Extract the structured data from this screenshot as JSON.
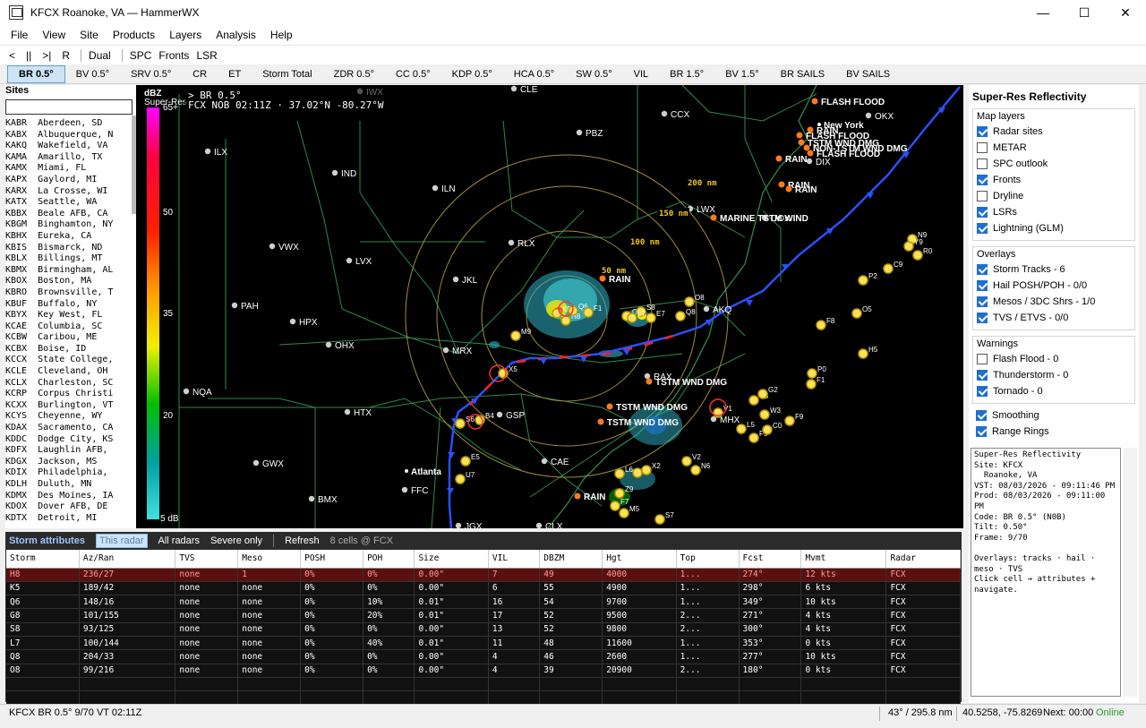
{
  "window": {
    "title": "KFCX Roanoke, VA — HammerWX",
    "min": "—",
    "max": "☐",
    "close": "✕"
  },
  "menu": [
    "File",
    "View",
    "Site",
    "Products",
    "Layers",
    "Analysis",
    "Help"
  ],
  "toolbar": {
    "prev": "<",
    "pause": "||",
    "next": ">|",
    "reset": "R",
    "dual": "Dual",
    "spc": "SPC",
    "fronts": "Fronts",
    "lsr": "LSR"
  },
  "product_tabs": [
    "BR 0.5°",
    "BV 0.5°",
    "SRV 0.5°",
    "CR",
    "ET",
    "Storm Total",
    "ZDR 0.5°",
    "CC 0.5°",
    "KDP 0.5°",
    "HCA 0.5°",
    "SW 0.5°",
    "VIL",
    "BR 1.5°",
    "BV 1.5°",
    "BR SAILS",
    "BV SAILS"
  ],
  "sites": {
    "header": "Sites",
    "list": [
      "KABR  Aberdeen, SD",
      "KABX  Albuquerque, N",
      "KAKQ  Wakefield, VA",
      "KAMA  Amarillo, TX",
      "KAMX  Miami, FL",
      "KAPX  Gaylord, MI",
      "KARX  La Crosse, WI",
      "KATX  Seattle, WA",
      "KBBX  Beale AFB, CA",
      "KBGM  Binghamton, NY",
      "KBHX  Eureka, CA",
      "KBIS  Bismarck, ND",
      "KBLX  Billings, MT",
      "KBMX  Birmingham, AL",
      "KBOX  Boston, MA",
      "KBRO  Brownsville, T",
      "KBUF  Buffalo, NY",
      "KBYX  Key West, FL",
      "KCAE  Columbia, SC",
      "KCBW  Caribou, ME",
      "KCBX  Boise, ID",
      "KCCX  State College,",
      "KCLE  Cleveland, OH",
      "KCLX  Charleston, SC",
      "KCRP  Corpus Christi",
      "KCXX  Burlington, VT",
      "KCYS  Cheyenne, WY",
      "KDAX  Sacramento, CA",
      "KDDC  Dodge City, KS",
      "KDFX  Laughlin AFB,",
      "KDGX  Jackson, MS",
      "KDIX  Philadelphia,",
      "KDLH  Duluth, MN",
      "KDMX  Des Moines, IA",
      "KDOX  Dover AFB, DE",
      "KDTX  Detroit, MI"
    ]
  },
  "map": {
    "info": "> BR 0.5°",
    "info2": "FCX NOB 02:11Z · 37.02°N -80.27°W",
    "legend_title": "dBZ",
    "legend_sub": "Super-Res",
    "legend_ticks": [
      "65+",
      "50",
      "35",
      "20",
      "5 dB"
    ],
    "sites": [
      "IWX",
      "CLE",
      "CCX",
      "PBZ",
      "ILX",
      "IND",
      "ILN",
      "LWX",
      "DOX",
      "VWX",
      "LVX",
      "RLX",
      "JKL",
      "PAH",
      "HPX",
      "OHX",
      "MRX",
      "AKQ",
      "RAX",
      "NQA",
      "HTX",
      "GSP",
      "MHX",
      "GWX",
      "CAE",
      "FFC",
      "BMX",
      "CLX",
      "JGX",
      "OKX",
      "DIX"
    ],
    "cities": [
      "New York",
      "Atlanta"
    ],
    "range_labels": [
      "50 nm",
      "100 nm",
      "150 nm",
      "200 nm"
    ],
    "lsr_labels": [
      "FLASH FLOOD",
      "RAIN",
      "FLASH FLOOD",
      "TSTM WND DMG",
      "NON-TSTM WND DMG",
      "FLASH FLOOD",
      "RAIN",
      "RAIN",
      "RAIN",
      "MARINE TSTM WIND",
      "RAIN",
      "TSTM WND DMG",
      "TSTM WND DMG",
      "TSTM WND DMG",
      "RAIN"
    ],
    "cells": [
      "H8",
      "K5",
      "Q6",
      "G8",
      "S8",
      "L7",
      "Q8",
      "O8",
      "M9",
      "X5",
      "B4",
      "S6",
      "F1",
      "E7",
      "N9",
      "Y9",
      "R0",
      "C9",
      "P2",
      "F8",
      "P0",
      "H5",
      "O5",
      "C3",
      "G2",
      "F1",
      "I7",
      "V1",
      "L5",
      "F5",
      "C0",
      "V2",
      "N6",
      "L6",
      "X2",
      "Z9",
      "F7",
      "M5",
      "S7",
      "E5",
      "U7",
      "F9",
      "W3"
    ]
  },
  "right": {
    "title": "Super-Res Reflectivity",
    "map_layers_title": "Map layers",
    "map_layers": [
      {
        "label": "Radar sites",
        "on": true
      },
      {
        "label": "METAR",
        "on": false
      },
      {
        "label": "SPC outlook",
        "on": false
      },
      {
        "label": "Fronts",
        "on": true
      },
      {
        "label": "Dryline",
        "on": false
      },
      {
        "label": "LSRs",
        "on": true
      },
      {
        "label": "Lightning (GLM)",
        "on": true
      }
    ],
    "overlays_title": "Overlays",
    "overlays": [
      {
        "label": "Storm Tracks - 6",
        "on": true
      },
      {
        "label": "Hail POSH/POH - 0/0",
        "on": true
      },
      {
        "label": "Mesos / 3DC Shrs - 1/0",
        "on": true
      },
      {
        "label": "TVS / ETVS - 0/0",
        "on": true
      }
    ],
    "warnings_title": "Warnings",
    "warnings": [
      {
        "label": "Flash Flood - 0",
        "on": false
      },
      {
        "label": "Thunderstorm - 0",
        "on": true
      },
      {
        "label": "Tornado - 0",
        "on": true
      }
    ],
    "smoothing": "Smoothing",
    "range_rings": "Range Rings",
    "info": "Super-Res Reflectivity\nSite: KFCX\n  Roanoke, VA\nVST: 08/03/2026 - 09:11:46 PM\nProd: 08/03/2026 - 09:11:00 PM\nCode: BR 0.5° (N0B)\nTilt: 0.50°\nFrame: 9/70\n\nOverlays: tracks · hail · meso · TVS\nClick cell → attributes + navigate."
  },
  "attributes": {
    "title": "Storm attributes",
    "this_radar": "This radar",
    "all_radars": "All radars",
    "severe_only": "Severe only",
    "refresh": "Refresh",
    "count": "8 cells @ FCX",
    "columns": [
      "Storm",
      "Az/Ran",
      "TVS",
      "Meso",
      "POSH",
      "POH",
      "Size",
      "VIL",
      "DBZM",
      "Hgt",
      "Top",
      "Fcst",
      "Mvmt",
      "Radar"
    ],
    "rows": [
      [
        "H8",
        "236/27",
        "none",
        "1",
        "0%",
        "0%",
        "0.00\"",
        "7",
        "49",
        "4000",
        "1...",
        "274°",
        "12 kts",
        "FCX"
      ],
      [
        "K5",
        "189/42",
        "none",
        "none",
        "0%",
        "0%",
        "0.00\"",
        "6",
        "55",
        "4900",
        "1...",
        "298°",
        "6 kts",
        "FCX"
      ],
      [
        "Q6",
        "148/16",
        "none",
        "none",
        "0%",
        "10%",
        "0.01\"",
        "16",
        "54",
        "9700",
        "1...",
        "349°",
        "10 kts",
        "FCX"
      ],
      [
        "G8",
        "101/155",
        "none",
        "none",
        "0%",
        "20%",
        "0.01\"",
        "17",
        "52",
        "9500",
        "2...",
        "271°",
        "4 kts",
        "FCX"
      ],
      [
        "S8",
        "93/125",
        "none",
        "none",
        "0%",
        "0%",
        "0.00\"",
        "13",
        "52",
        "9800",
        "2...",
        "300°",
        "4 kts",
        "FCX"
      ],
      [
        "L7",
        "100/144",
        "none",
        "none",
        "0%",
        "40%",
        "0.01\"",
        "11",
        "48",
        "11600",
        "1...",
        "353°",
        "0 kts",
        "FCX"
      ],
      [
        "Q8",
        "204/33",
        "none",
        "none",
        "0%",
        "0%",
        "0.00\"",
        "4",
        "46",
        "2600",
        "1...",
        "277°",
        "10 kts",
        "FCX"
      ],
      [
        "O8",
        "99/216",
        "none",
        "none",
        "0%",
        "0%",
        "0.00\"",
        "4",
        "39",
        "20900",
        "2...",
        "180°",
        "0 kts",
        "FCX"
      ]
    ]
  },
  "status": {
    "left": "KFCX  BR 0.5°  9/70  VT 02:11Z",
    "azran": "43° / 295.8 nm",
    "latlon": "40.5258, -75.8269",
    "next": "Next: 00:00",
    "online": "Online"
  }
}
